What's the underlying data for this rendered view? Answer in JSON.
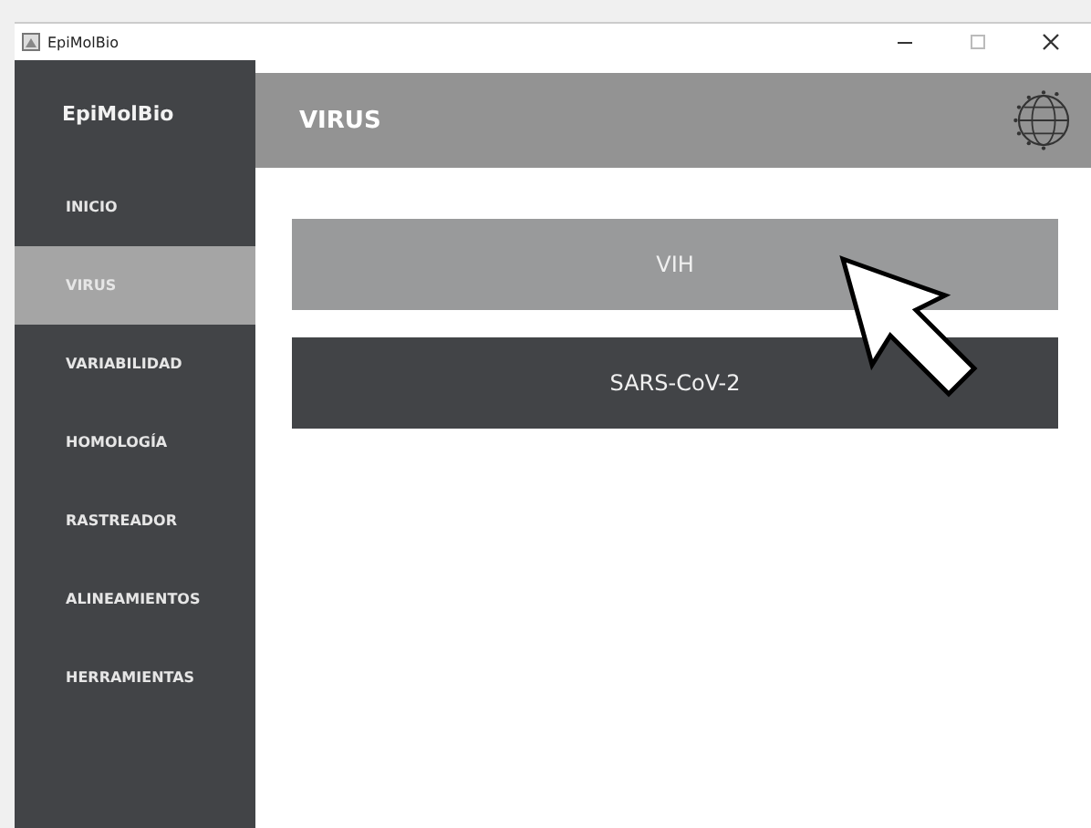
{
  "window": {
    "title": "EpiMolBio"
  },
  "sidebar": {
    "title": "EpiMolBio",
    "items": [
      {
        "label": "INICIO",
        "selected": false
      },
      {
        "label": "VIRUS",
        "selected": true
      },
      {
        "label": "VARIABILIDAD",
        "selected": false
      },
      {
        "label": "HOMOLOGÍA",
        "selected": false
      },
      {
        "label": "RASTREADOR",
        "selected": false
      },
      {
        "label": "ALINEAMIENTOS",
        "selected": false
      },
      {
        "label": "HERRAMIENTAS",
        "selected": false
      }
    ]
  },
  "header": {
    "title": "VIRUS"
  },
  "options": [
    {
      "label": "VIH",
      "hovered": true
    },
    {
      "label": "SARS-CoV-2",
      "hovered": false
    }
  ]
}
